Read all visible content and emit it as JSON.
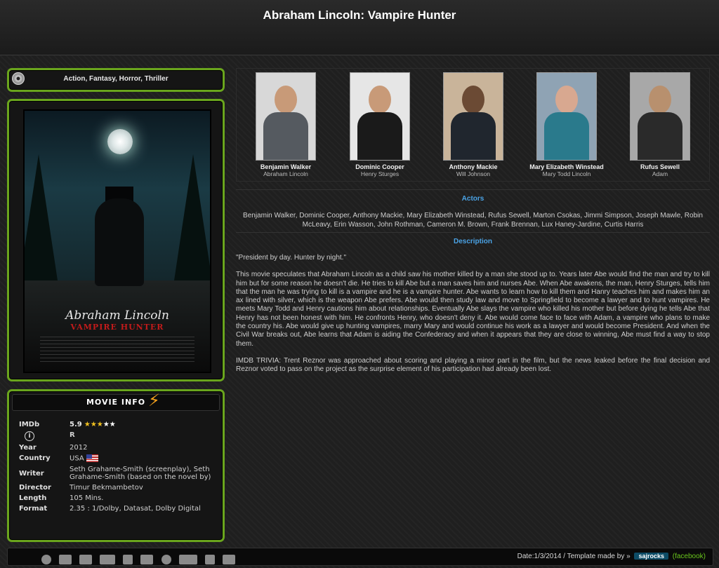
{
  "title": "Abraham Lincoln: Vampire Hunter",
  "genres": "Action, Fantasy, Horror, Thriller",
  "poster": {
    "title": "Abraham Lincoln",
    "subtitle": "VAMPIRE HUNTER"
  },
  "cast": [
    {
      "name": "Benjamin Walker",
      "role": "Abraham Lincoln"
    },
    {
      "name": "Dominic Cooper",
      "role": "Henry Sturges"
    },
    {
      "name": "Anthony Mackie",
      "role": "Will Johnson"
    },
    {
      "name": "Mary Elizabeth Winstead",
      "role": "Mary Todd Lincoln"
    },
    {
      "name": "Rufus Sewell",
      "role": "Adam"
    }
  ],
  "actors_heading": "Actors",
  "actors_text": "Benjamin Walker, Dominic Cooper, Anthony Mackie, Mary Elizabeth Winstead, Rufus Sewell, Marton Csokas, Jimmi Simpson, Joseph Mawle, Robin McLeavy, Erin Wasson, John Rothman, Cameron M. Brown, Frank Brennan, Lux Haney-Jardine, Curtis Harris",
  "description_heading": "Description",
  "description": {
    "tagline": "\"President by day. Hunter by night.\"",
    "plot": "This movie speculates that Abraham Lincoln as a child saw his mother killed by a man she stood up to. Years later Abe would find the man and try to kill him but for some reason he doesn't die. He tries to kill Abe but a man saves him and nurses Abe. When Abe awakens, the man, Henry Sturges, tells him that the man he was trying to kill is a vampire and he is a vampire hunter. Abe wants to learn how to kill them and Hanry teaches him and makes him an ax lined with silver, which is the weapon Abe prefers. Abe would then study law and move to Springfield to become a lawyer and to hunt vampires. He meets Mary Todd and Henry cautions him about relationships. Eventually Abe slays the vampire who killed his mother but before dying he tells Abe that Henry has not been honest with him. He confronts Henry, who doesn't deny it. Abe would come face to face with Adam, a vampire who plans to make the country his. Abe would give up hunting vampires, marry Mary and would continue his work as a lawyer and would become President. And when the Civil War breaks out, Abe learns that Adam is aiding the Confederacy and when it appears that they are close to winning, Abe must find a way to stop them.",
    "trivia": "IMDB TRIVIA: Trent Reznor was approached about scoring and playing a minor part in the film, but the news leaked before the final decision and Reznor voted to pass on the project as the surprise element of his participation had already been lost."
  },
  "movie_info": {
    "heading": "MOVIE INFO",
    "imdb_label": "IMDb",
    "imdb_score": "5.9",
    "stars_on": "★★★",
    "stars_off": "★★",
    "rating": "R",
    "rows": [
      {
        "label": "Year",
        "value": "2012"
      },
      {
        "label": "Country",
        "value": "USA"
      },
      {
        "label": "Writer",
        "value": "Seth Grahame-Smith (screenplay), Seth Grahame-Smith (based on the novel by)"
      },
      {
        "label": "Director",
        "value": "Timur Bekmambetov"
      },
      {
        "label": "Length",
        "value": "105 Mins."
      },
      {
        "label": "Format",
        "value": "2.35 : 1/Dolby, Datasat, Dolby Digital"
      }
    ]
  },
  "footer": {
    "date_text": "Date:1/3/2014 / Template made by »",
    "badge": "sajrocks",
    "facebook": "(facebook)"
  },
  "colors": {
    "accent_green": "#6aa51d",
    "heading_blue": "#4aa3e6"
  }
}
